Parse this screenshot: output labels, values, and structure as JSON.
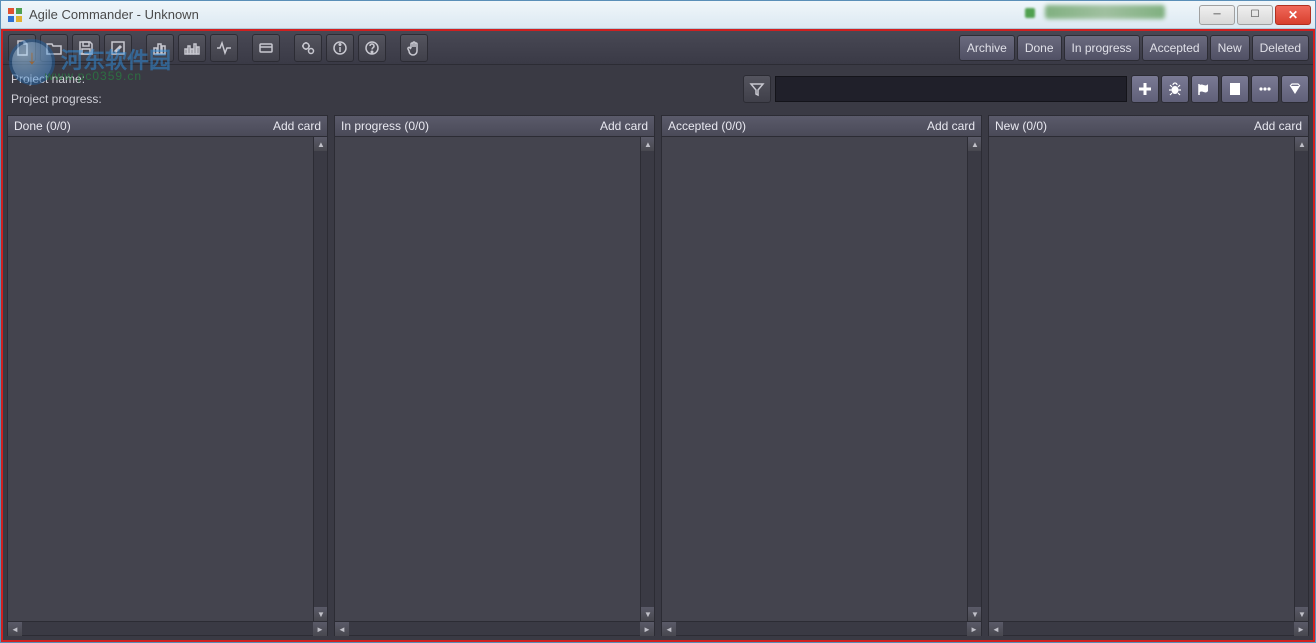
{
  "window": {
    "title": "Agile Commander - Unknown"
  },
  "filter_tabs": [
    "Archive",
    "Done",
    "In progress",
    "Accepted",
    "New",
    "Deleted"
  ],
  "info": {
    "project_name_label": "Project name:",
    "project_progress_label": "Project progress:"
  },
  "search": {
    "value": ""
  },
  "toolbar_icons": [
    "new-file-icon",
    "open-folder-icon",
    "save-icon",
    "edit-note-icon",
    "sep",
    "bar-chart-icon",
    "chart-group-icon",
    "activity-icon",
    "sep",
    "card-icon",
    "sep",
    "gears-icon",
    "info-icon",
    "help-icon",
    "sep",
    "hand-icon"
  ],
  "action_icons": [
    "plus-icon",
    "bug-icon",
    "tag-icon",
    "note-icon",
    "more-icon",
    "diamond-icon"
  ],
  "columns": [
    {
      "title": "Done (0/0)",
      "add": "Add card"
    },
    {
      "title": "In progress (0/0)",
      "add": "Add card"
    },
    {
      "title": "Accepted (0/0)",
      "add": "Add card"
    },
    {
      "title": "New (0/0)",
      "add": "Add card"
    }
  ],
  "watermark": {
    "brand": "河东软件园",
    "url": "www.pc0359.cn"
  }
}
